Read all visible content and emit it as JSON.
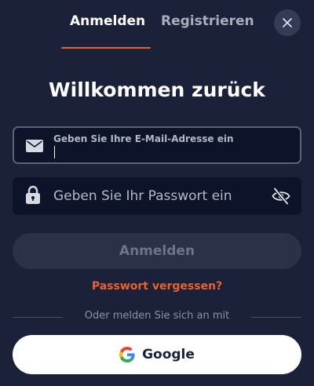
{
  "tabs": {
    "login_label": "Anmelden",
    "register_label": "Registrieren",
    "active": "login"
  },
  "close": {
    "icon": "close-icon"
  },
  "title": "Willkommen zurück",
  "email": {
    "label": "Geben Sie Ihre E-Mail-Adresse ein",
    "value": "",
    "icon": "envelope-icon"
  },
  "password": {
    "placeholder": "Geben Sie Ihr Passwort ein",
    "value": "",
    "icon": "lock-icon",
    "toggle_icon": "eye-slash-icon"
  },
  "submit": {
    "label": "Anmelden"
  },
  "forgot": {
    "label": "Passwort vergessen?"
  },
  "divider": {
    "text": "Oder melden Sie sich an mit"
  },
  "google": {
    "label": "Google",
    "icon": "google-icon"
  },
  "colors": {
    "background": "#1b2138",
    "field_background": "#0d1329",
    "accent": "#e8632c",
    "disabled_button": "#2b3148",
    "muted_text": "#8c91a3"
  }
}
